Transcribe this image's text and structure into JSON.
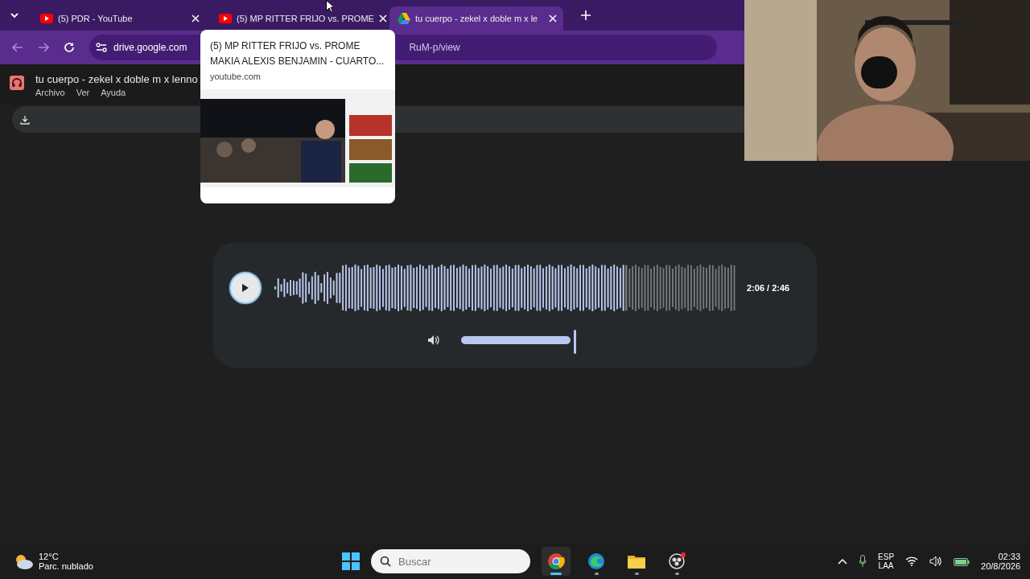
{
  "tabs": [
    {
      "title": "(5) PDR - YouTube",
      "kind": "youtube",
      "selected": false
    },
    {
      "title": "(5) MP RITTER FRIJO vs. PROME",
      "kind": "youtube",
      "selected": false
    },
    {
      "title": "tu cuerpo - zekel x doble m x le",
      "kind": "drive",
      "selected": true
    }
  ],
  "address_bar": {
    "host": "drive.google.com",
    "tail": "RuM-p/view"
  },
  "tab_preview": {
    "title": "(5) MP RITTER FRIJO vs. PROME MAKIA ALEXIS BENJAMIN - CUARTO...",
    "site": "youtube.com"
  },
  "document": {
    "title": "tu cuerpo - zekel x doble m x lenno",
    "menu": [
      "Archivo",
      "Ver",
      "Ayuda"
    ]
  },
  "player": {
    "progress": {
      "level": 0.76
    },
    "time": "2:06 / 2:46",
    "volume": {
      "level": 1
    }
  },
  "taskbar": {
    "weather": {
      "temp": "12°C",
      "condition": "Parc. nublado"
    },
    "search": {
      "placeholder": "Buscar"
    },
    "apps": [
      {
        "kind": "chrome",
        "selected": true
      },
      {
        "kind": "edge",
        "selected": false
      },
      {
        "kind": "folder",
        "selected": false
      },
      {
        "kind": "obs",
        "selected": false
      }
    ],
    "language": [
      "ESP",
      "LAA"
    ],
    "time": "02:33",
    "date": "20/8/2026"
  }
}
